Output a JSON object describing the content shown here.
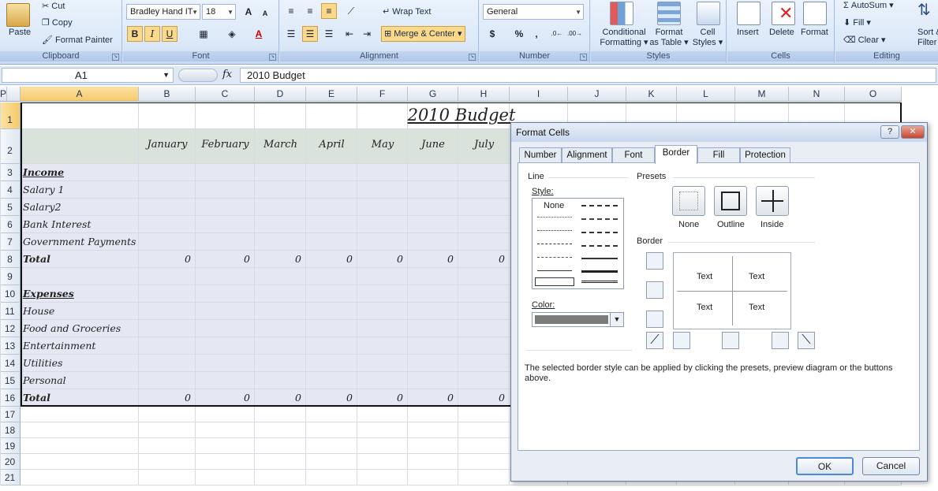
{
  "ribbon": {
    "clipboard": {
      "label": "Clipboard",
      "paste": "Paste",
      "cut": "Cut",
      "copy": "Copy",
      "format_painter": "Format Painter"
    },
    "font": {
      "label": "Font",
      "family": "Bradley Hand IT",
      "size": "18",
      "bold": "B",
      "italic": "I",
      "underline": "U",
      "grow": "A",
      "shrink": "A",
      "color_a": "A"
    },
    "alignment": {
      "label": "Alignment",
      "wrap": "Wrap Text",
      "merge": "Merge & Center"
    },
    "number": {
      "label": "Number",
      "format": "General",
      "currency": "$",
      "percent": "%",
      "comma": ","
    },
    "styles": {
      "label": "Styles",
      "conditional": "Conditional",
      "conditional2": "Formatting",
      "format_table": "Format",
      "format_table2": "as Table",
      "cell_styles": "Cell",
      "cell_styles2": "Styles"
    },
    "cells": {
      "label": "Cells",
      "insert": "Insert",
      "delete": "Delete",
      "format": "Format"
    },
    "editing": {
      "label": "Editing",
      "autosum": "AutoSum",
      "fill": "Fill",
      "clear": "Clear",
      "sort": "Sort &",
      "filter": "Filter"
    }
  },
  "formula_bar": {
    "name_box": "A1",
    "fx": "fx",
    "content": "2010 Budget"
  },
  "grid": {
    "columns": [
      "A",
      "B",
      "C",
      "D",
      "E",
      "F",
      "G",
      "H",
      "I",
      "J",
      "K",
      "L",
      "M",
      "N",
      "O",
      "P"
    ],
    "rows": [
      "1",
      "2",
      "3",
      "4",
      "5",
      "6",
      "7",
      "8",
      "9",
      "10",
      "11",
      "12",
      "13",
      "14",
      "15",
      "16",
      "17",
      "18",
      "19",
      "20",
      "21"
    ],
    "title": "2010 Budget",
    "months": [
      "January",
      "February",
      "March",
      "April",
      "May",
      "June",
      "July"
    ],
    "labels": [
      "Income",
      "Salary 1",
      "Salary2",
      "Bank Interest",
      "Government Payments",
      "Total",
      "",
      "Expenses",
      "House",
      "Food and Groceries",
      "Entertainment",
      "Utilities",
      "Personal",
      "Total"
    ],
    "zero": "0"
  },
  "dialog": {
    "title": "Format Cells",
    "help": "?",
    "close": "✕",
    "tabs": [
      "Number",
      "Alignment",
      "Font",
      "Border",
      "Fill",
      "Protection"
    ],
    "active_tab": "Border",
    "line_label": "Line",
    "style_label": "Style:",
    "none_style": "None",
    "color_label": "Color:",
    "presets_label": "Presets",
    "presets": [
      "None",
      "Outline",
      "Inside"
    ],
    "border_label": "Border",
    "preview_text": "Text",
    "hint": "The selected border style can be applied by clicking the presets, preview diagram or the buttons above.",
    "ok": "OK",
    "cancel": "Cancel"
  }
}
